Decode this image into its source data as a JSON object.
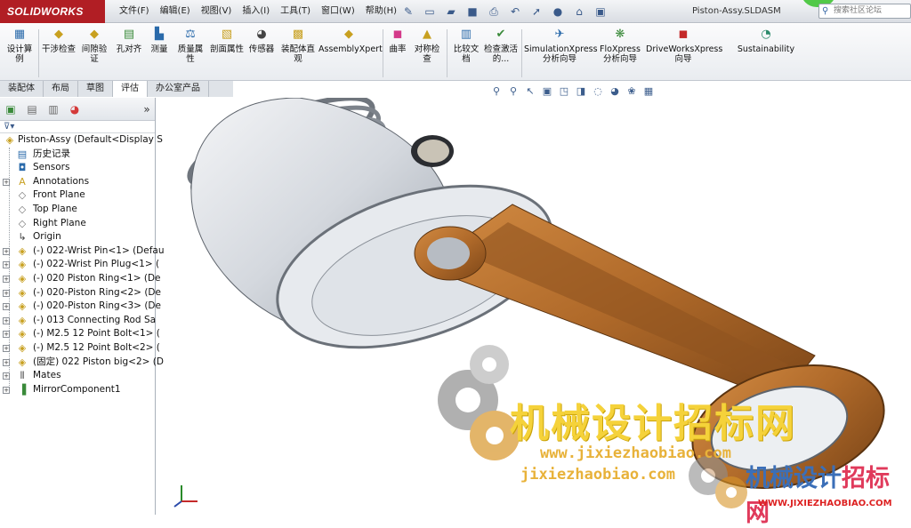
{
  "app": {
    "logo": "SOLIDWORKS",
    "doc_title": "Piston-Assy.SLDASM"
  },
  "menu": [
    "文件(F)",
    "编辑(E)",
    "视图(V)",
    "插入(I)",
    "工具(T)",
    "窗口(W)",
    "帮助(H)"
  ],
  "search": {
    "placeholder": "搜索社区论坛"
  },
  "ribbon": {
    "design_study": "设计算例",
    "interference": "干涉检查",
    "clearance": "间隙验证",
    "hole_align": "孔对齐",
    "measure": "测量",
    "mass_props": "质量属性",
    "section_props": "剖面属性",
    "sensor": "传感器",
    "assembly_visual": "装配体直观",
    "assemblyxpert": "AssemblyXpert",
    "curvature": "曲率",
    "symmetry": "对称检查",
    "compare": "比较文档",
    "activation": "检查激活的...",
    "simulationxpress": "SimulationXpress分析向导",
    "floxpress": "FloXpress分析向导",
    "driveworksxpress": "DriveWorksXpress向导",
    "sustainability": "Sustainability"
  },
  "tabs": [
    "装配体",
    "布局",
    "草图",
    "评估",
    "办公室产品"
  ],
  "tree": {
    "root": "Piston-Assy  (Default<Display S",
    "items": [
      "历史记录",
      "Sensors",
      "Annotations",
      "Front Plane",
      "Top Plane",
      "Right Plane",
      "Origin",
      "(-) 022-Wrist Pin<1> (Defau",
      "(-) 022-Wrist Pin Plug<1> (",
      "(-) 020 Piston Ring<1> (De",
      "(-) 020-Piston Ring<2> (De",
      "(-) 020-Piston Ring<3> (De",
      "(-) 013 Connecting Rod Sa",
      "(-) M2.5 12 Point Bolt<1> (",
      "(-) M2.5 12 Point Bolt<2> (",
      "(固定) 022 Piston big<2> (D",
      "Mates",
      "MirrorComponent1"
    ]
  },
  "watermark": {
    "title": "机械设计招标网",
    "url1": "www.jixiezhaobiao.com",
    "url2": "jixiezhaobiao.com",
    "cn2_a": "机械设计",
    "cn2_b": "招标网",
    "url3": "WWW.JIXIEZHAOBIAO.COM"
  },
  "colors": {
    "brand": "#b11e24",
    "rod": "#b06a2a",
    "piston": "#d9dde3",
    "watermark": "#f5d23a"
  }
}
